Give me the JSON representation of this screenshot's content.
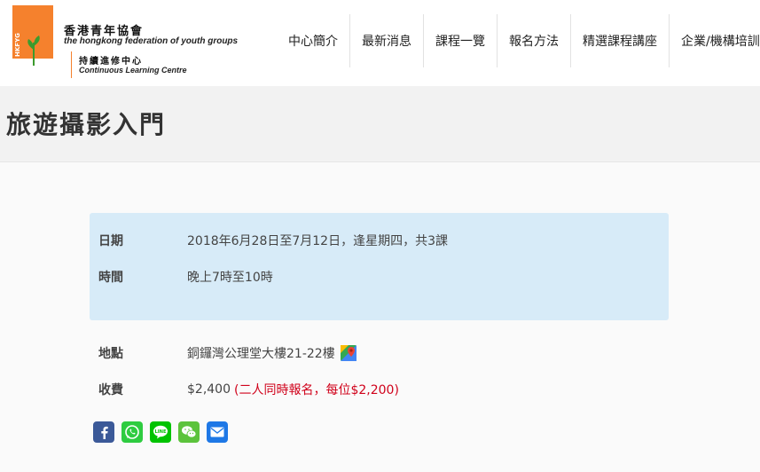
{
  "header": {
    "logo_text": "HKFYG",
    "org_cn": "香港青年協會",
    "org_en": "the hongkong federation of youth groups",
    "clc_cn": "持續進修中心",
    "clc_en": "Continuous Learning Centre"
  },
  "nav": {
    "items": [
      {
        "label": "中心簡介"
      },
      {
        "label": "最新消息"
      },
      {
        "label": "課程一覽"
      },
      {
        "label": "報名方法"
      },
      {
        "label": "精選課程講座"
      },
      {
        "label": "企業/機構培訓"
      }
    ]
  },
  "course": {
    "title": "旅遊攝影入門",
    "date_label": "日期",
    "date_value": "2018年6月28日至7月12日，逢星期四，共3課",
    "time_label": "時間",
    "time_value": "晚上7時至10時",
    "venue_label": "地點",
    "venue_value": "銅鑼灣公理堂大樓21-22樓",
    "fee_label": "收費",
    "fee_value": "$2,400",
    "fee_note": "(二人同時報名，每位$2,200)"
  },
  "share": {
    "icons": [
      "facebook-icon",
      "whatsapp-icon",
      "line-icon",
      "wechat-icon",
      "email-icon"
    ]
  },
  "colors": {
    "brand_orange": "#f5812d",
    "info_bg": "#d7ebf8",
    "fee_note": "#d0021b"
  }
}
